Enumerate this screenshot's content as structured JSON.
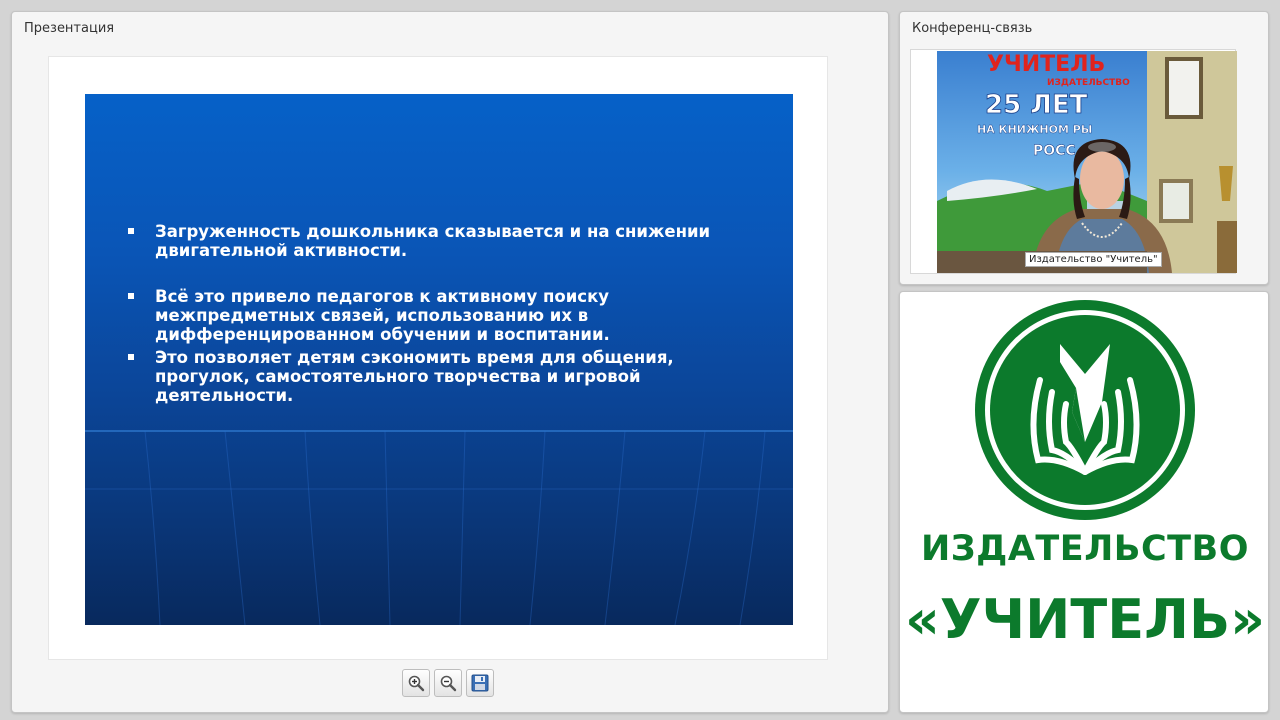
{
  "presentation": {
    "title": "Презентация",
    "slide": {
      "bullets": [
        " Загруженность дошкольника сказывается и на снижении двигательной активности.",
        "Всё это привело педагогов к активному поиску межпредметных связей, использованию их в дифференцированном обучении и воспитании.",
        " Это позволяет детям сэкономить время для общения, прогулок, самостоятельного творчества и игровой деятельности."
      ]
    },
    "toolbar": {
      "zoom_in_icon": "zoom-in-icon",
      "zoom_out_icon": "zoom-out-icon",
      "save_icon": "save-icon"
    }
  },
  "conference": {
    "title": "Конференц-связь",
    "video": {
      "caption": "Издательство \"Учитель\"",
      "banner_lines": [
        "УЧИТЕЛЬ",
        "ИЗДАТЕЛЬСТВО",
        "25 ЛЕТ",
        "НА КНИЖНОМ РЫ",
        "РОСС"
      ]
    }
  },
  "logo_panel": {
    "line1": "ИЗДАТЕЛЬСТВО",
    "line2": "«УЧИТЕЛЬ»"
  },
  "colors": {
    "slide_top": "#0661c8",
    "slide_bottom": "#08295d",
    "brand_green": "#0c7a2c"
  }
}
